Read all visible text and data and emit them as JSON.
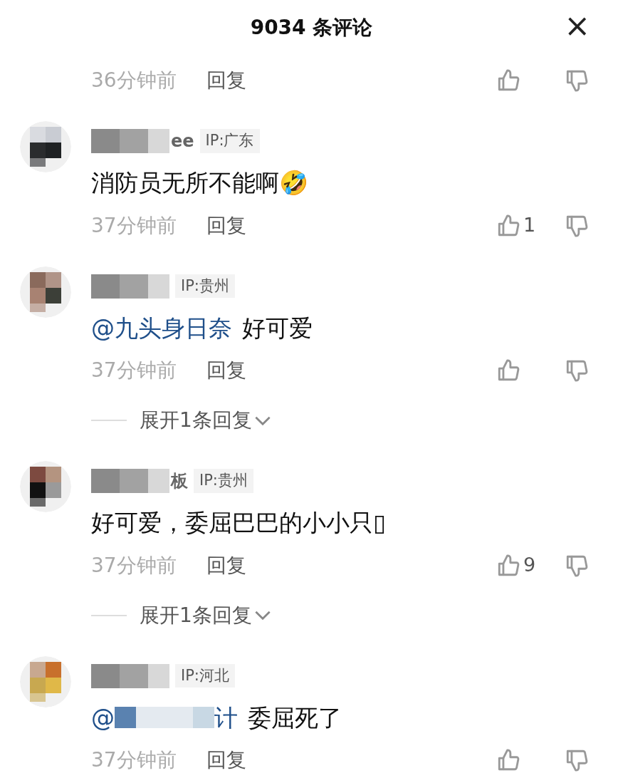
{
  "header": {
    "title": "9034 条评论",
    "close": "×"
  },
  "comments": [
    {
      "time": "36分钟前",
      "reply": "回复"
    },
    {
      "name_fragment": "ee",
      "ip": "IP:广东",
      "text": "消防员无所不能啊🤣",
      "time": "37分钟前",
      "reply": "回复",
      "likes": "1"
    },
    {
      "ip": "IP:贵州",
      "mention": "@九头身日奈",
      "text": "好可爱",
      "time": "37分钟前",
      "reply": "回复",
      "expand": "展开1条回复"
    },
    {
      "name_fragment": "板",
      "ip": "IP:贵州",
      "text": "好可爱，委屈巴巴的小小只▯",
      "time": "37分钟前",
      "reply": "回复",
      "likes": "9",
      "expand": "展开1条回复"
    },
    {
      "ip": "IP:河北",
      "mention": "@",
      "mention_end": "计",
      "text": "委屈死了",
      "time": "37分钟前",
      "reply": "回复"
    }
  ]
}
